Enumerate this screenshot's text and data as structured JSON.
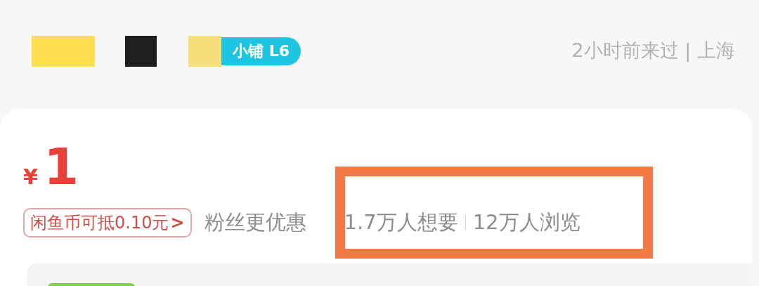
{
  "header": {
    "redaction_blocks": [
      {
        "color": "#ffdf4f"
      },
      {
        "color": "#1e1e1e"
      },
      {
        "color": "#f8df7a"
      }
    ],
    "seller_badge": "小铺 L6",
    "last_visit": "2小时前来过 | 上海"
  },
  "price": {
    "currency": "¥",
    "amount": "1"
  },
  "coupon": {
    "label": "闲鱼币可抵0.10元",
    "chevron": ">"
  },
  "fan_offer": "粉丝更优惠",
  "stats": [
    "1.7万人想要",
    "12万人浏览"
  ]
}
